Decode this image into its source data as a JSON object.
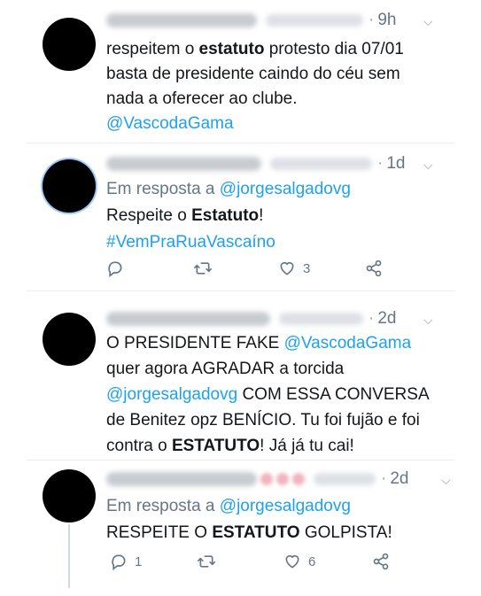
{
  "tweets": [
    {
      "time": "9h",
      "line1_pre": "respeitem o ",
      "line1_bold": "estatuto",
      "line1_post": " protesto dia 07/01",
      "line2": "basta de presidente caindo do céu sem",
      "line3": "nada a oferecer ao clube.",
      "line4_mention": "@VascodaGama"
    },
    {
      "time": "1d",
      "reply_label": "Em resposta a",
      "reply_to": "@jorgesalgadovg",
      "text_pre": "Respeite o ",
      "text_bold": "Estatuto",
      "text_post": "!",
      "hashtag": "#VemPraRuaVascaíno",
      "like_count": "3"
    },
    {
      "time": "2d",
      "line1_pre": "O PRESIDENTE FAKE ",
      "line1_mention": "@VascodaGama",
      "line2": "quer agora AGRADAR a torcida",
      "line3_mention": "@jorgesalgadovg",
      "line3_post": " COM ESSA CONVERSA",
      "line4": "de Benitez opz BENÍCIO.  Tu foi fujão e foi",
      "line5_pre": "contra o ",
      "line5_bold": "ESTATUTO",
      "line5_post": "! Já já tu cai!"
    },
    {
      "time": "2d",
      "reply_label": "Em resposta a",
      "reply_to": "@jorgesalgadovg",
      "text_pre": "RESPEITE O ",
      "text_bold": "ESTATUTO",
      "text_post": " GOLPISTA!",
      "reply_count": "1",
      "like_count": "6"
    }
  ],
  "ui": {
    "dot": "·",
    "chevron": "⌵"
  },
  "icons": {
    "reply": "reply-icon",
    "retweet": "retweet-icon",
    "like": "heart-icon",
    "share": "share-icon",
    "more": "chevron-down-icon"
  },
  "colors": {
    "link": "#1da1f2",
    "secondary": "#657786",
    "separator": "#e6ecf0"
  }
}
